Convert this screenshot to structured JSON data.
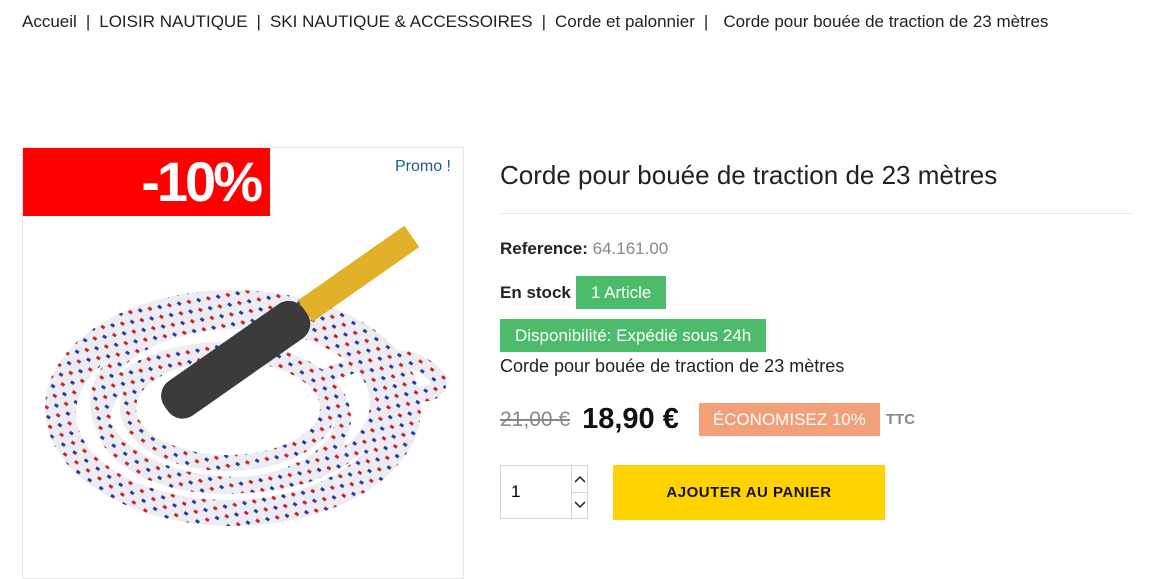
{
  "breadcrumb": {
    "items": [
      "Accueil",
      "LOISIR NAUTIQUE",
      "SKI NAUTIQUE & ACCESSOIRES",
      "Corde et palonnier"
    ],
    "separator": "|",
    "current": "Corde pour bouée de traction de 23 mètres"
  },
  "image": {
    "discount_flag": "-10%",
    "promo_label": "Promo !"
  },
  "product": {
    "title": "Corde pour bouée de traction de 23 mètres",
    "reference_label": "Reference:",
    "reference_value": "64.161.00",
    "stock_label": "En stock",
    "stock_badge": "1 Article",
    "availability": "Disponibilité: Expédié sous 24h",
    "short_description": "Corde pour bouée de traction de 23 mètres"
  },
  "pricing": {
    "old_price": "21,00 €",
    "price": "18,90 €",
    "savings": "ÉCONOMISEZ 10%",
    "tax_label": "TTC"
  },
  "cart": {
    "quantity": "1",
    "add_to_cart": "AJOUTER AU PANIER"
  },
  "colors": {
    "discount_red": "#ff0000",
    "stock_green": "#4cbb6c",
    "savings_orange": "#f1a07a",
    "cart_yellow": "#ffd200",
    "promo_blue": "#1b5e8a"
  }
}
